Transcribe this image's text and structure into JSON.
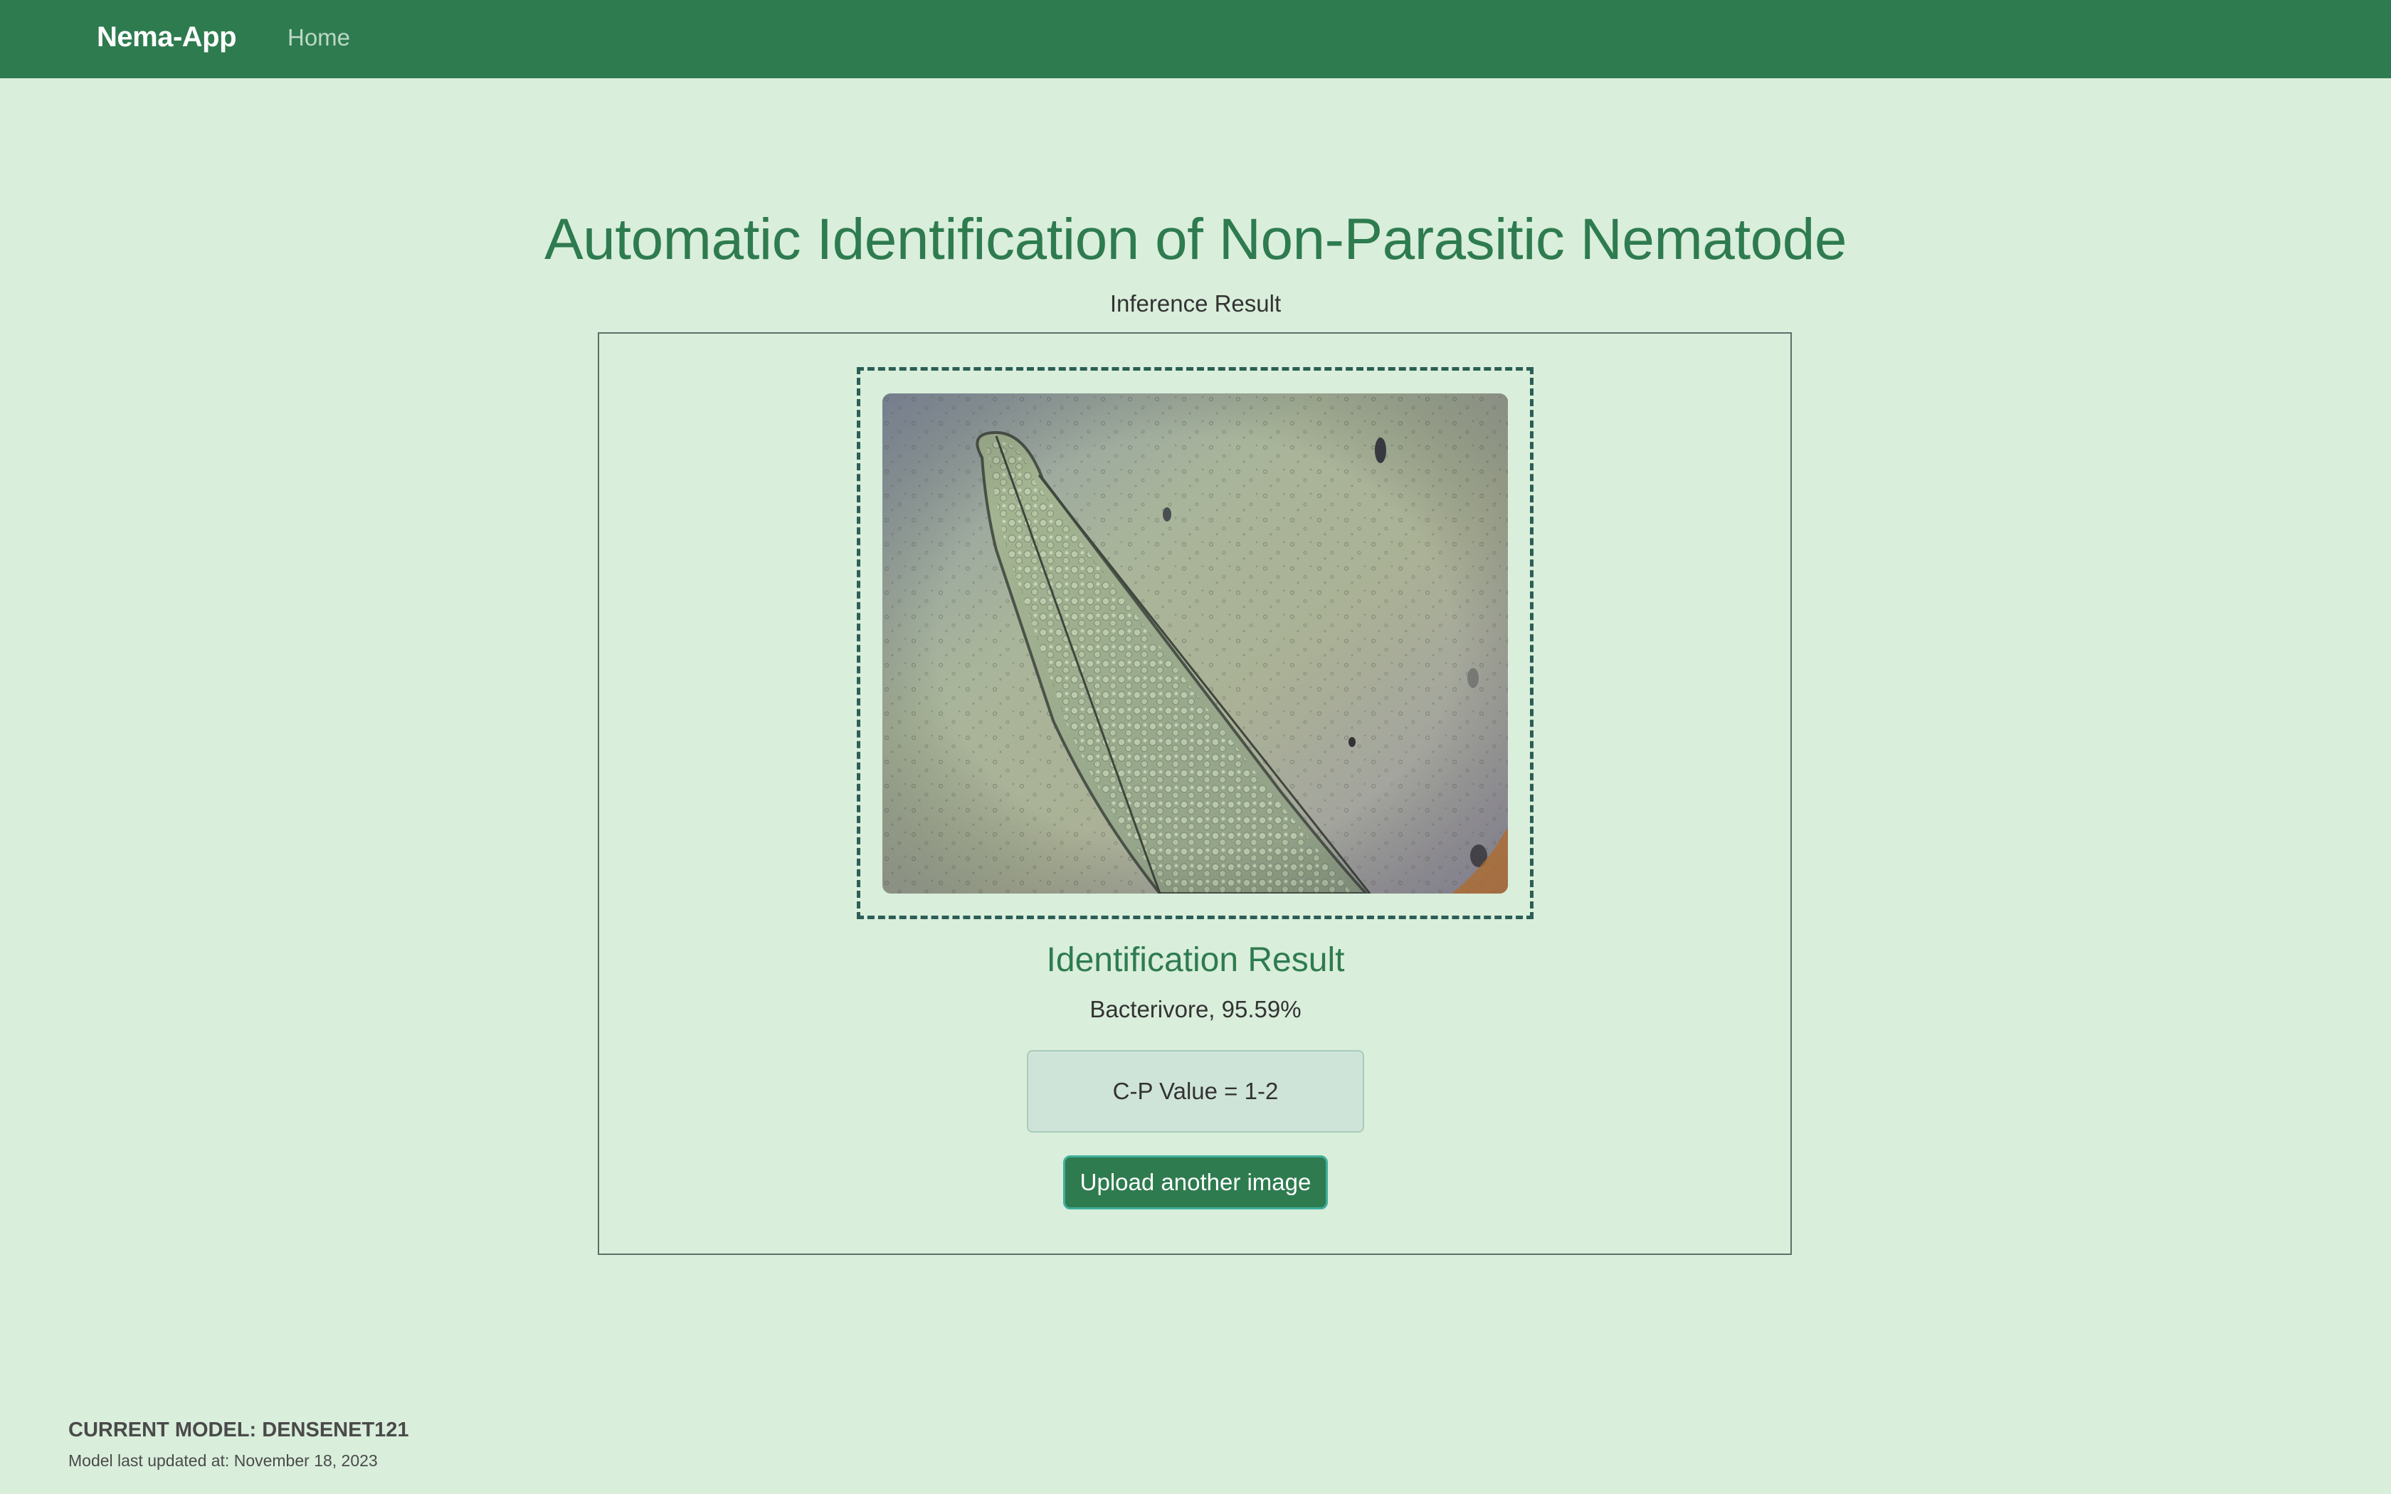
{
  "navbar": {
    "brand": "Nema-App",
    "links": [
      {
        "label": "Home"
      }
    ],
    "color": "#2e7b4f"
  },
  "main": {
    "title": "Automatic Identification of Non-Parasitic Nematode",
    "subtitle": "Inference Result",
    "image": {
      "description_icon": "microscope-image",
      "alt": "Uploaded nematode image"
    },
    "result_heading": "Identification Result",
    "result_text": "Bacterivore, 95.59%",
    "cp_value": "C-P Value = 1-2",
    "upload_button": "Upload another image"
  },
  "footer": {
    "current_model": "CURRENT MODEL: DENSENET121",
    "last_updated": "Model last updated at: November 18, 2023"
  },
  "colors": {
    "background": "#d9eedb",
    "accent": "#2e7b4f",
    "cp_box": "#cfe4d8",
    "button_border": "#3fae9b"
  }
}
